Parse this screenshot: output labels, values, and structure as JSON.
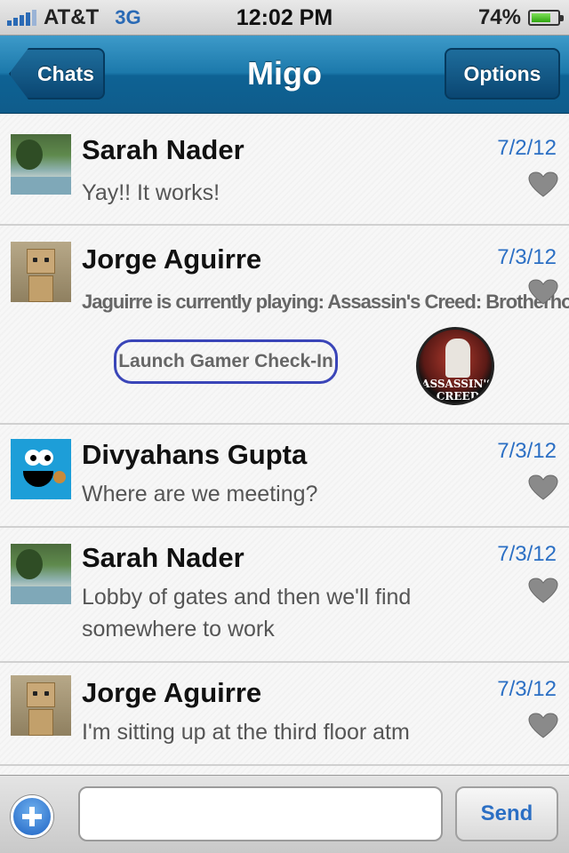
{
  "status_bar": {
    "carrier": "AT&T",
    "network": "3G",
    "time": "12:02 PM",
    "battery_percent": "74%",
    "battery_level": 0.74
  },
  "nav": {
    "back_label": "Chats",
    "title": "Migo",
    "options_label": "Options"
  },
  "messages": [
    {
      "name": "Sarah Nader",
      "date": "7/2/12",
      "text": "Yay!! It works!"
    },
    {
      "name": "Jorge Aguirre",
      "date": "7/3/12",
      "text": "Jaguirre is currently playing: Assassin's Creed: Brotherhood",
      "action": "Launch Gamer Check-In",
      "game_logo_text": "ASSASSIN'S CREED BROTHERHOOD"
    },
    {
      "name": "Divyahans Gupta",
      "date": "7/3/12",
      "text": "Where are we meeting?"
    },
    {
      "name": "Sarah Nader",
      "date": "7/3/12",
      "text": "Lobby of gates and then we'll find somewhere to work"
    },
    {
      "name": "Jorge Aguirre",
      "date": "7/3/12",
      "text": "I'm sitting up at the third floor atm"
    }
  ],
  "input_bar": {
    "placeholder": "",
    "send_label": "Send"
  },
  "colors": {
    "nav_blue": "#1c79ab",
    "date_blue": "#2b6fc4",
    "heart_gray": "#8a8a8a",
    "gamer_button_border": "#3a45b8"
  }
}
